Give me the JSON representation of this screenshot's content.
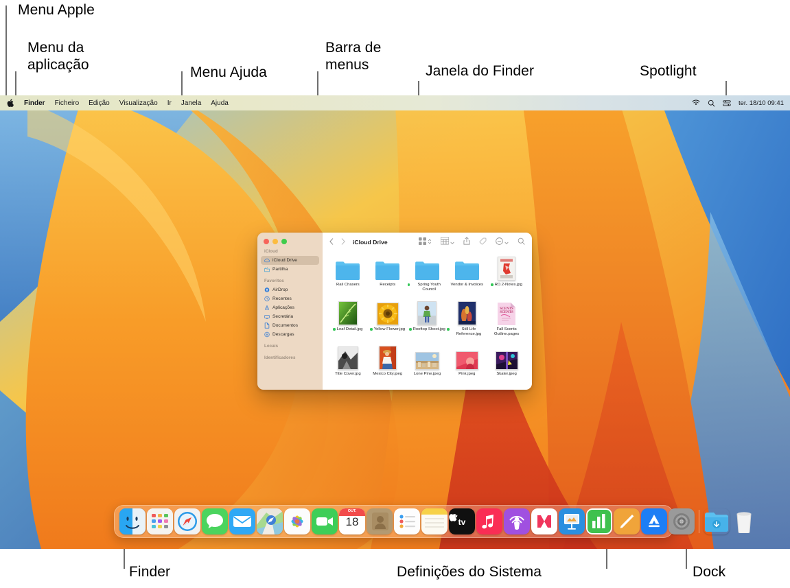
{
  "annotations": [
    {
      "id": "menu-apple",
      "label": "Menu Apple"
    },
    {
      "id": "menu-aplicacao",
      "label": "Menu da\naplicação"
    },
    {
      "id": "menu-ajuda",
      "label": "Menu Ajuda"
    },
    {
      "id": "barra-menus",
      "label": "Barra de\nmenus"
    },
    {
      "id": "janela-finder",
      "label": "Janela do Finder"
    },
    {
      "id": "spotlight",
      "label": "Spotlight"
    },
    {
      "id": "finder",
      "label": "Finder"
    },
    {
      "id": "definicoes",
      "label": "Definições do Sistema"
    },
    {
      "id": "dock",
      "label": "Dock"
    }
  ],
  "menubar": {
    "apple_icon": "apple-logo-icon",
    "items": [
      {
        "label": "Finder",
        "bold": true
      },
      {
        "label": "Ficheiro",
        "bold": false
      },
      {
        "label": "Edição",
        "bold": false
      },
      {
        "label": "Visualização",
        "bold": false
      },
      {
        "label": "Ir",
        "bold": false
      },
      {
        "label": "Janela",
        "bold": false
      },
      {
        "label": "Ajuda",
        "bold": false
      }
    ],
    "status_icons": [
      "wifi-icon",
      "spotlight-search-icon",
      "control-center-icon"
    ],
    "clock": "ter. 18/10  09:41"
  },
  "finder_window": {
    "title": "iCloud Drive",
    "traffic_lights": [
      "close-button",
      "minimize-button",
      "zoom-button"
    ],
    "toolbar": {
      "back_icon": "chevron-left-icon",
      "forward_icon": "chevron-right-icon",
      "view_icon": "icon-view-icon",
      "view_stepper_icon": "up-down-chevron-icon",
      "group_icon": "group-by-icon",
      "group_chevron": "chevron-down-icon",
      "share_icon": "share-icon",
      "tag_icon": "tag-icon",
      "action_icon": "action-menu-icon",
      "action_chevron": "chevron-down-icon",
      "search_icon": "search-icon"
    },
    "sidebar": [
      {
        "type": "section",
        "label": "iCloud"
      },
      {
        "type": "item",
        "label": "iCloud Drive",
        "icon": "icloud-icon",
        "selected": true
      },
      {
        "type": "item",
        "label": "Partilha",
        "icon": "shared-folder-icon",
        "selected": false
      },
      {
        "type": "section",
        "label": "Favoritos"
      },
      {
        "type": "item",
        "label": "AirDrop",
        "icon": "airdrop-icon",
        "selected": false
      },
      {
        "type": "item",
        "label": "Recentes",
        "icon": "clock-icon",
        "selected": false
      },
      {
        "type": "item",
        "label": "Aplicações",
        "icon": "applications-icon",
        "selected": false
      },
      {
        "type": "item",
        "label": "Secretária",
        "icon": "desktop-icon",
        "selected": false
      },
      {
        "type": "item",
        "label": "Documentos",
        "icon": "document-icon",
        "selected": false
      },
      {
        "type": "item",
        "label": "Descargas",
        "icon": "downloads-icon",
        "selected": false
      },
      {
        "type": "section",
        "label": "Locais"
      },
      {
        "type": "section",
        "label": "Identificadores"
      }
    ],
    "files": [
      {
        "name": "Rail Chasers",
        "kind": "folder",
        "badge": false
      },
      {
        "name": "Receipts",
        "kind": "folder",
        "badge": false
      },
      {
        "name": "Spring Youth Council",
        "kind": "folder",
        "badge": true
      },
      {
        "name": "Vendor & Invoices",
        "kind": "folder",
        "badge": false
      },
      {
        "name": "RD.2-Notes.jpg",
        "kind": "image",
        "badge": true,
        "thumb": "notes-sketch"
      },
      {
        "name": "Leaf Detail.jpg",
        "kind": "image",
        "badge": true,
        "thumb": "leaf"
      },
      {
        "name": "Yellow Flower.jpg",
        "kind": "image",
        "badge": true,
        "thumb": "sunflower"
      },
      {
        "name": "Rooftop Shoot.jpg",
        "kind": "image",
        "badge": true,
        "thumb": "rooftop"
      },
      {
        "name": "Still Life Reference.jpg",
        "kind": "image",
        "badge": true,
        "thumb": "stilllife"
      },
      {
        "name": "Fall Scents Outline.pages",
        "kind": "pages",
        "badge": false,
        "thumb": "pages-doc"
      },
      {
        "name": "Title Cover.jpg",
        "kind": "image",
        "badge": false,
        "thumb": "titlecover"
      },
      {
        "name": "Mexico City.jpeg",
        "kind": "image",
        "badge": false,
        "thumb": "mexicocity"
      },
      {
        "name": "Lone Pine.jpeg",
        "kind": "image",
        "badge": false,
        "thumb": "lonepine"
      },
      {
        "name": "Pink.jpeg",
        "kind": "image",
        "badge": false,
        "thumb": "pink"
      },
      {
        "name": "Skater.jpeg",
        "kind": "image",
        "badge": false,
        "thumb": "skater"
      }
    ]
  },
  "dock": {
    "apps": [
      {
        "name": "Finder",
        "icon": "finder-icon",
        "running": true
      },
      {
        "name": "Launchpad",
        "icon": "launchpad-icon",
        "running": false
      },
      {
        "name": "Safari",
        "icon": "safari-icon",
        "running": false
      },
      {
        "name": "Mensagens",
        "icon": "messages-icon",
        "running": false
      },
      {
        "name": "Mail",
        "icon": "mail-icon",
        "running": false
      },
      {
        "name": "Mapas",
        "icon": "maps-icon",
        "running": false
      },
      {
        "name": "Fotografias",
        "icon": "photos-icon",
        "running": false
      },
      {
        "name": "FaceTime",
        "icon": "facetime-icon",
        "running": false
      },
      {
        "name": "Calendário",
        "icon": "calendar-icon",
        "running": false,
        "month": "OUT.",
        "day": "18"
      },
      {
        "name": "Contactos",
        "icon": "contacts-icon",
        "running": false
      },
      {
        "name": "Lembretes",
        "icon": "reminders-icon",
        "running": false
      },
      {
        "name": "Notas",
        "icon": "notes-icon",
        "running": false
      },
      {
        "name": "Apple TV",
        "icon": "appletv-icon",
        "running": false
      },
      {
        "name": "Música",
        "icon": "music-icon",
        "running": false
      },
      {
        "name": "Podcasts",
        "icon": "podcasts-icon",
        "running": false
      },
      {
        "name": "News",
        "icon": "news-icon",
        "running": false
      },
      {
        "name": "Keynote",
        "icon": "keynote-icon",
        "running": false
      },
      {
        "name": "Numbers",
        "icon": "numbers-icon",
        "running": false
      },
      {
        "name": "Pages",
        "icon": "pages-icon",
        "running": false
      },
      {
        "name": "App Store",
        "icon": "appstore-icon",
        "running": false
      },
      {
        "name": "Definições do Sistema",
        "icon": "system-settings-icon",
        "running": false
      }
    ],
    "extras": [
      {
        "name": "Descargas",
        "icon": "downloads-folder-icon"
      },
      {
        "name": "Lixo",
        "icon": "trash-icon"
      }
    ]
  },
  "colors": {
    "accent_green": "#34c759",
    "folder_blue": "#4dbbf0",
    "sidebar_bg": "#edd9c4",
    "selection": "#d4bfa8"
  }
}
